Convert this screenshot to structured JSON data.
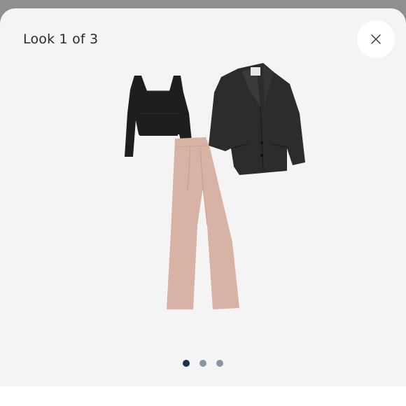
{
  "modal": {
    "title": "Look 1 of 3",
    "close_icon": "close-icon"
  },
  "look": {
    "items": [
      "cropped-square-neck-top",
      "single-breasted-blazer",
      "wide-leg-trousers"
    ],
    "colors": {
      "top": "#1e1e1e",
      "blazer": "#2c2c2c",
      "trousers": "#d8b3a5"
    }
  },
  "pagination": {
    "total": 3,
    "current": 1,
    "active_color": "#1f3348",
    "inactive_color": "#8796a3"
  }
}
